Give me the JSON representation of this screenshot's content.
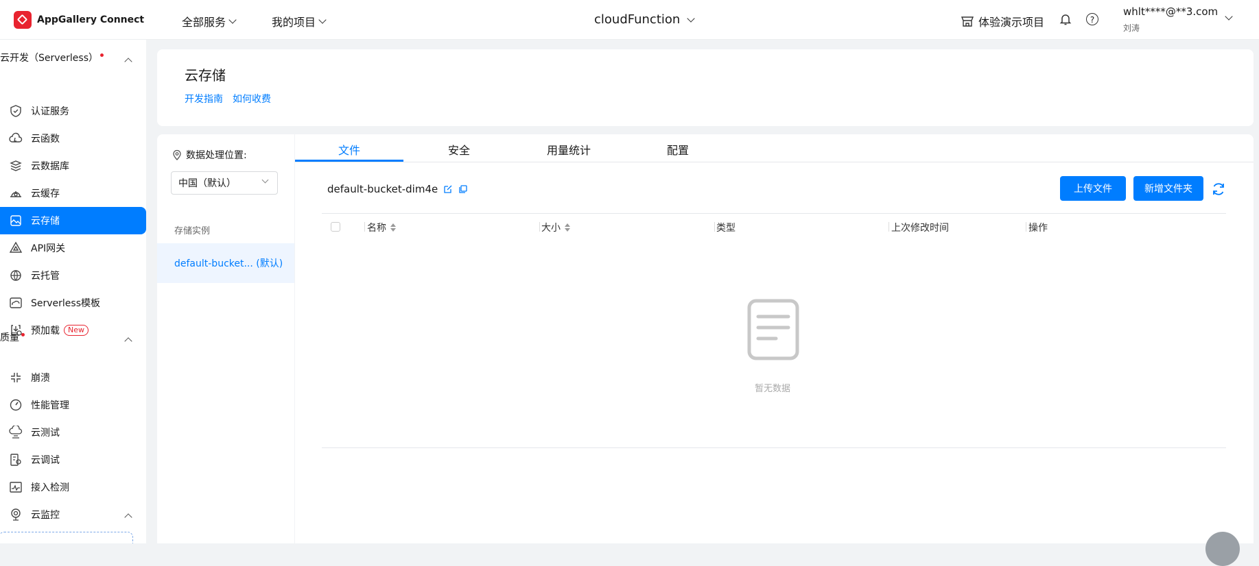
{
  "header": {
    "brand": "AppGallery Connect",
    "menus": [
      "全部服务",
      "我的项目"
    ],
    "project": "cloudFunction",
    "demo_label": "体验演示项目",
    "help_glyph": "?",
    "user_email": "whlt****@**3.com",
    "user_name": "刘涛"
  },
  "sidebar": {
    "group1_title": "云开发（Serverless）",
    "group1_items": [
      {
        "label": "认证服务",
        "icon": "shield-icon"
      },
      {
        "label": "云函数",
        "icon": "cloud-function-icon"
      },
      {
        "label": "云数据库",
        "icon": "database-icon"
      },
      {
        "label": "云缓存",
        "icon": "cache-icon"
      },
      {
        "label": "云存储",
        "icon": "storage-icon",
        "active": true
      },
      {
        "label": "API网关",
        "icon": "gateway-icon"
      },
      {
        "label": "云托管",
        "icon": "globe-icon"
      },
      {
        "label": "Serverless模板",
        "icon": "template-icon"
      },
      {
        "label": "预加载",
        "icon": "preload-icon",
        "badge": "New"
      }
    ],
    "group2_title": "质量",
    "group2_items": [
      {
        "label": "崩溃",
        "icon": "crash-icon"
      },
      {
        "label": "性能管理",
        "icon": "gauge-icon"
      },
      {
        "label": "云测试",
        "icon": "cloud-test-icon"
      },
      {
        "label": "云调试",
        "icon": "debug-icon"
      },
      {
        "label": "接入检测",
        "icon": "monitor-icon"
      },
      {
        "label": "云监控",
        "icon": "webcam-icon"
      }
    ]
  },
  "page": {
    "title": "云存储",
    "links": [
      "开发指南",
      "如何收费"
    ]
  },
  "left_panel": {
    "location_label": "数据处理位置:",
    "location_value": "中国（默认）",
    "instances_label": "存储实例",
    "instance_item": "default-bucket... (默认)"
  },
  "main": {
    "tabs": [
      "文件",
      "安全",
      "用量统计",
      "配置"
    ],
    "active_tab": "文件",
    "bucket_name": "default-bucket-dim4e",
    "upload_button": "上传文件",
    "new_folder_button": "新增文件夹",
    "columns": [
      "名称",
      "大小",
      "类型",
      "上次修改时间",
      "操作"
    ],
    "empty_text": "暂无数据"
  },
  "colors": {
    "accent": "#007dff",
    "brand_red": "#e8232f"
  }
}
